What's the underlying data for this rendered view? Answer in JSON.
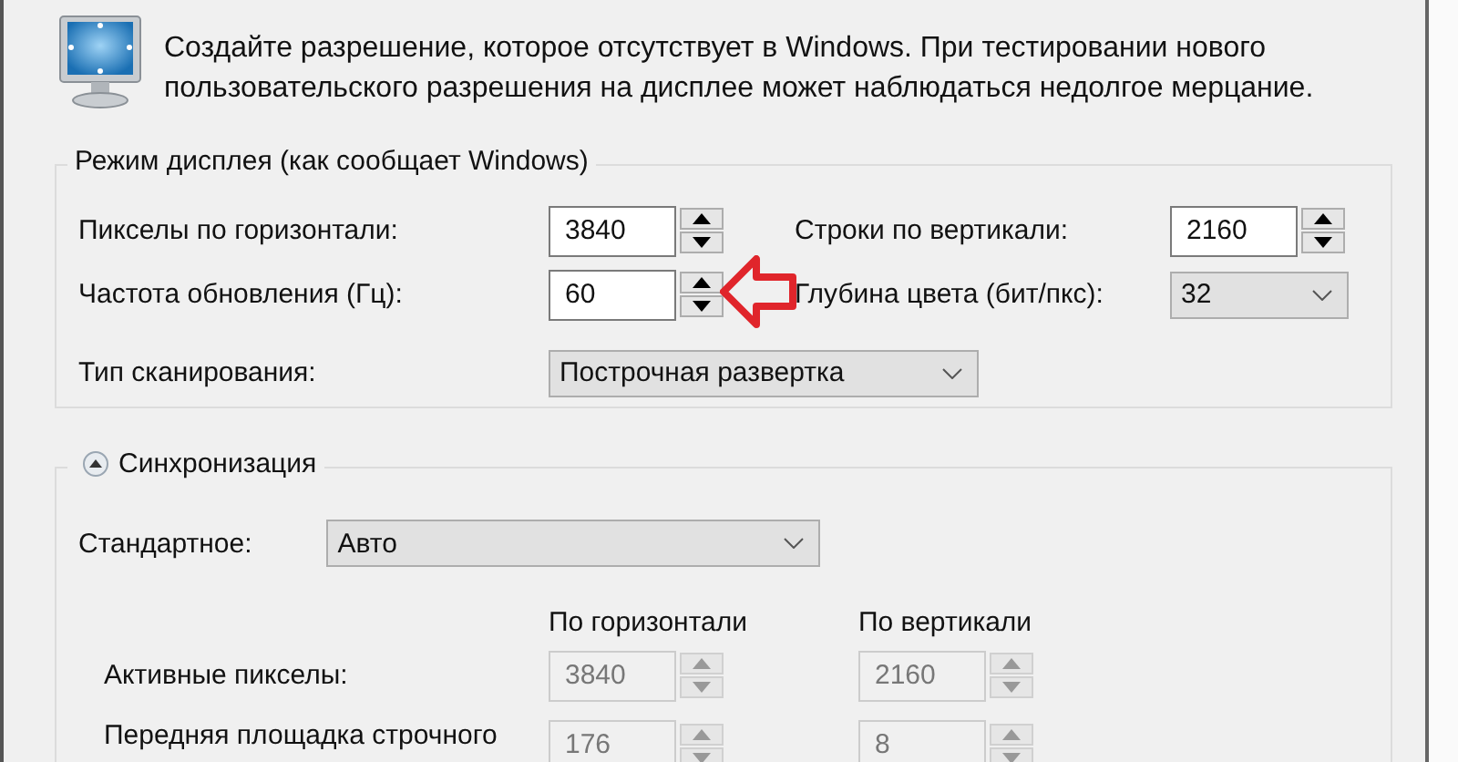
{
  "header": {
    "description": "Создайте разрешение, которое отсутствует в Windows. При тестировании нового пользовательского разрешения на дисплее может наблюдаться недолгое мерцание."
  },
  "display_mode": {
    "title": "Режим дисплея (как сообщает Windows)",
    "fields": [
      {
        "label": "Пикселы по горизонтали:",
        "value": "3840",
        "kind": "spin"
      },
      {
        "label": "Строки по вертикали:",
        "value": "2160",
        "kind": "spin"
      },
      {
        "label": "Частота обновления (Гц):",
        "value": "60",
        "kind": "spin"
      },
      {
        "label": "Глубина цвета (бит/пкс):",
        "value": "32",
        "kind": "select"
      },
      {
        "label": "Тип сканирования:",
        "value": "Построчная развертка",
        "kind": "select"
      }
    ]
  },
  "sync": {
    "title": "Синхронизация",
    "expanded": true,
    "standard": {
      "label": "Стандартное:",
      "value": "Авто"
    },
    "columns": [
      "По горизонтали",
      "По вертикали"
    ],
    "rows": [
      {
        "label": "Активные пикселы:",
        "horizontal": "3840",
        "vertical": "2160",
        "disabled": true
      },
      {
        "label": "Передняя площадка строчного",
        "horizontal": "176",
        "vertical": "8",
        "disabled": true
      }
    ]
  }
}
